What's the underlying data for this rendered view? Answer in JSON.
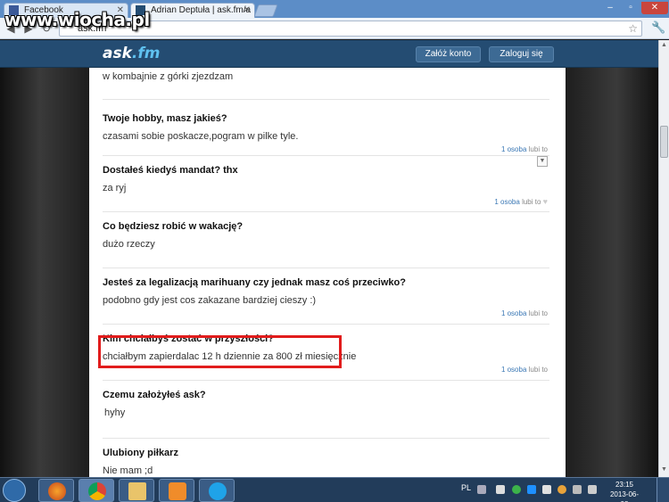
{
  "watermark": "www.wiocha.pl",
  "browser": {
    "tabs": [
      {
        "label": "Facebook",
        "icon": "facebook-icon"
      },
      {
        "label": "Adrian Deptuła | ask.fm/a",
        "icon": "askfm-icon"
      }
    ],
    "url": "ask.fm"
  },
  "site": {
    "logo_main": "ask",
    "logo_suffix": ".fm",
    "register_label": "Załóż konto",
    "login_label": "Zaloguj się"
  },
  "feed": [
    {
      "question": "",
      "answer": "w kombajnie z górki zjezdzam",
      "likes": ""
    },
    {
      "question": "Twoje hobby, masz jakieś?",
      "answer": "czasami sobie poskacze,pogram w pilke tyle.",
      "like_count": "1 osoba",
      "like_text": "lubi to"
    },
    {
      "question": "Dostałeś kiedyś mandat? thx",
      "answer": "za ryj",
      "like_count": "1 osoba",
      "like_text": "lubi to"
    },
    {
      "question": "Co będziesz robić w wakację?",
      "answer": "dużo rzeczy",
      "like_count": "",
      "like_text": ""
    },
    {
      "question": "Jesteś za legalizacją marihuany czy jednak masz coś przeciwko?",
      "answer": "podobno gdy jest cos zakazane bardziej cieszy :)",
      "like_count": "1 osoba",
      "like_text": "lubi to"
    },
    {
      "question": "Kim chciałbyś zostać w przyszłości?",
      "answer": "chciałbym zapierdalac 12 h dziennie za 800 zł miesięcznie",
      "like_count": "1 osoba",
      "like_text": "lubi to"
    },
    {
      "question": "Czemu założyłeś ask?",
      "answer": "hyhy",
      "like_count": "",
      "like_text": ""
    },
    {
      "question": "Ulubiony piłkarz",
      "answer": "Nie mam ;d",
      "like_count": "",
      "like_text": ""
    }
  ],
  "taskbar": {
    "lang": "PL",
    "time": "23:15",
    "date": "2013-06-08"
  },
  "colors": {
    "header": "#244c72",
    "highlight": "#e11c1c",
    "link": "#3b78b5"
  }
}
